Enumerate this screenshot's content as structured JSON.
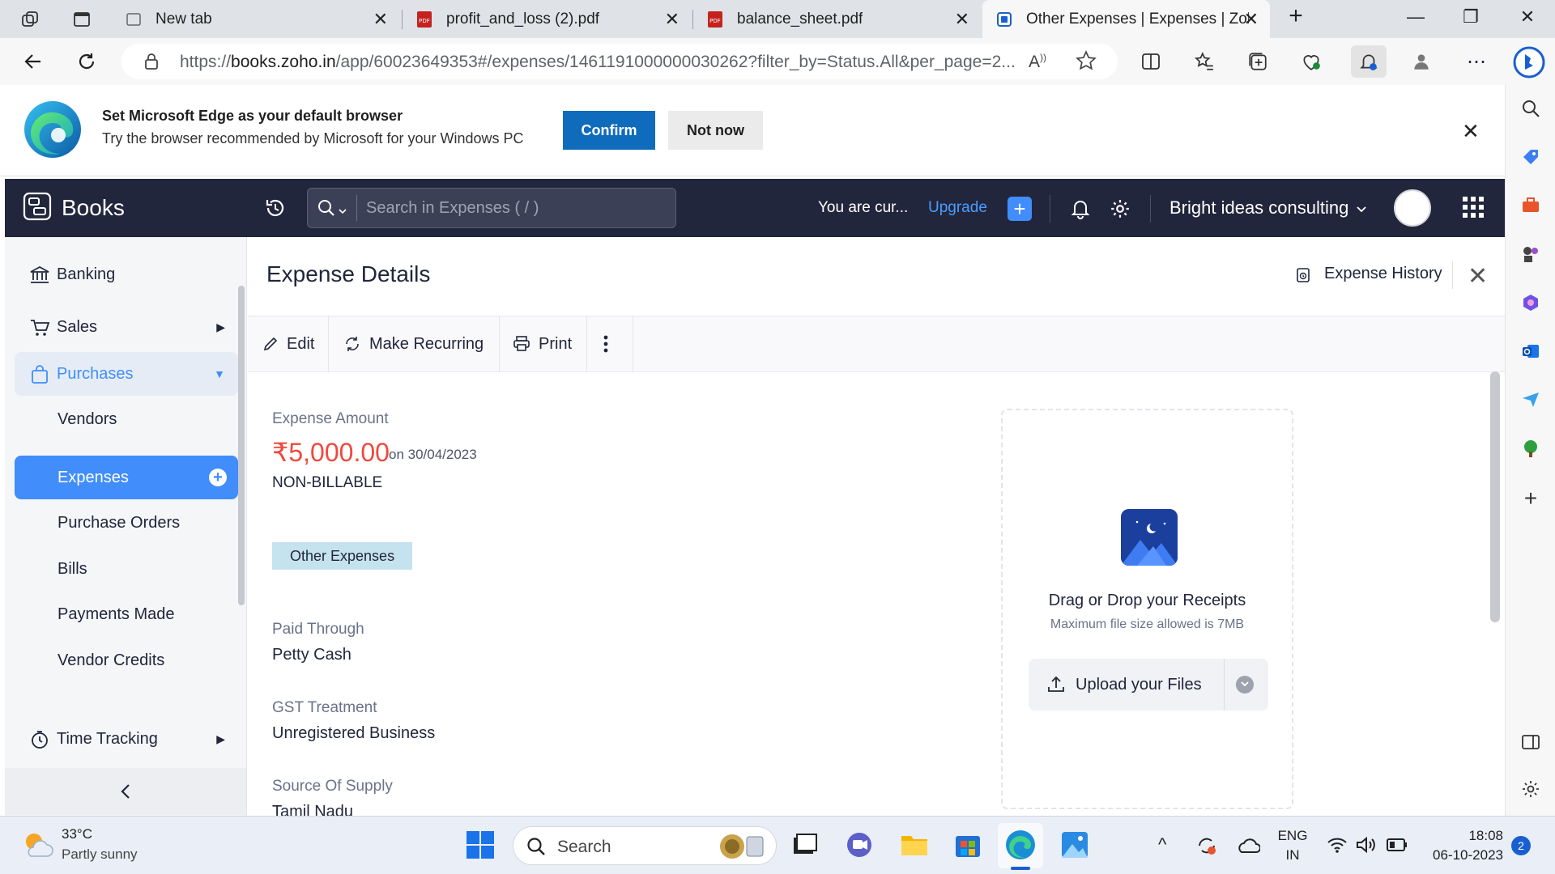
{
  "browser": {
    "tabs": [
      {
        "title": "New tab",
        "favicon": "new-tab-icon"
      },
      {
        "title": "profit_and_loss (2).pdf",
        "favicon": "pdf-icon"
      },
      {
        "title": "balance_sheet.pdf",
        "favicon": "pdf-icon"
      },
      {
        "title": "Other Expenses | Expenses | Zoho",
        "favicon": "zoho-books-icon",
        "active": true
      }
    ],
    "url_prefix": "https://",
    "url_host": "books.zoho.in",
    "url_path": "/app/60023649353#/expenses/1461191000000030262?filter_by=Status.All&per_page=2..."
  },
  "banner": {
    "title": "Set Microsoft Edge as your default browser",
    "subtitle": "Try the browser recommended by Microsoft for your Windows PC",
    "confirm_label": "Confirm",
    "notnow_label": "Not now"
  },
  "header": {
    "brand": "Books",
    "search_placeholder": "Search in Expenses ( / )",
    "trial_text": "You are cur...",
    "upgrade_label": "Upgrade",
    "org_name": "Bright ideas consulting"
  },
  "sidebar": {
    "items": [
      {
        "label": "Banking",
        "icon": "bank-icon"
      },
      {
        "label": "Sales",
        "icon": "cart-icon"
      },
      {
        "label": "Purchases",
        "icon": "bag-icon",
        "expanded": true
      },
      {
        "label": "Vendors"
      },
      {
        "label": "Expenses",
        "selected": true
      },
      {
        "label": "Purchase Orders"
      },
      {
        "label": "Bills"
      },
      {
        "label": "Payments Made"
      },
      {
        "label": "Vendor Credits"
      },
      {
        "label": "Time Tracking",
        "icon": "clock-icon"
      }
    ]
  },
  "detail": {
    "title": "Expense Details",
    "history_label": "Expense History",
    "toolbar": {
      "edit": "Edit",
      "recurring": "Make Recurring",
      "print": "Print"
    },
    "amount_label": "Expense Amount",
    "amount": "₹5,000.00",
    "amount_date": "on 30/04/2023",
    "billable": "NON-BILLABLE",
    "category_tag": "Other Expenses",
    "paid_through_label": "Paid Through",
    "paid_through": "Petty Cash",
    "gst_label": "GST Treatment",
    "gst": "Unregistered Business",
    "supply_label": "Source Of Supply",
    "supply": "Tamil Nadu"
  },
  "receipts": {
    "title": "Drag or Drop your Receipts",
    "subtitle": "Maximum file size allowed is 7MB",
    "upload_label": "Upload your Files"
  },
  "taskbar": {
    "temperature": "33°C",
    "weather": "Partly sunny",
    "search_label": "Search",
    "lang_top": "ENG",
    "lang_bottom": "IN",
    "time": "18:08",
    "date": "06-10-2023",
    "notifications": "2"
  },
  "colors": {
    "header_bg": "#21263c",
    "accent": "#408dfb",
    "amount": "#f0483e",
    "tag_bg": "#c5e3ee",
    "edge_blue": "#0f6cbd"
  }
}
